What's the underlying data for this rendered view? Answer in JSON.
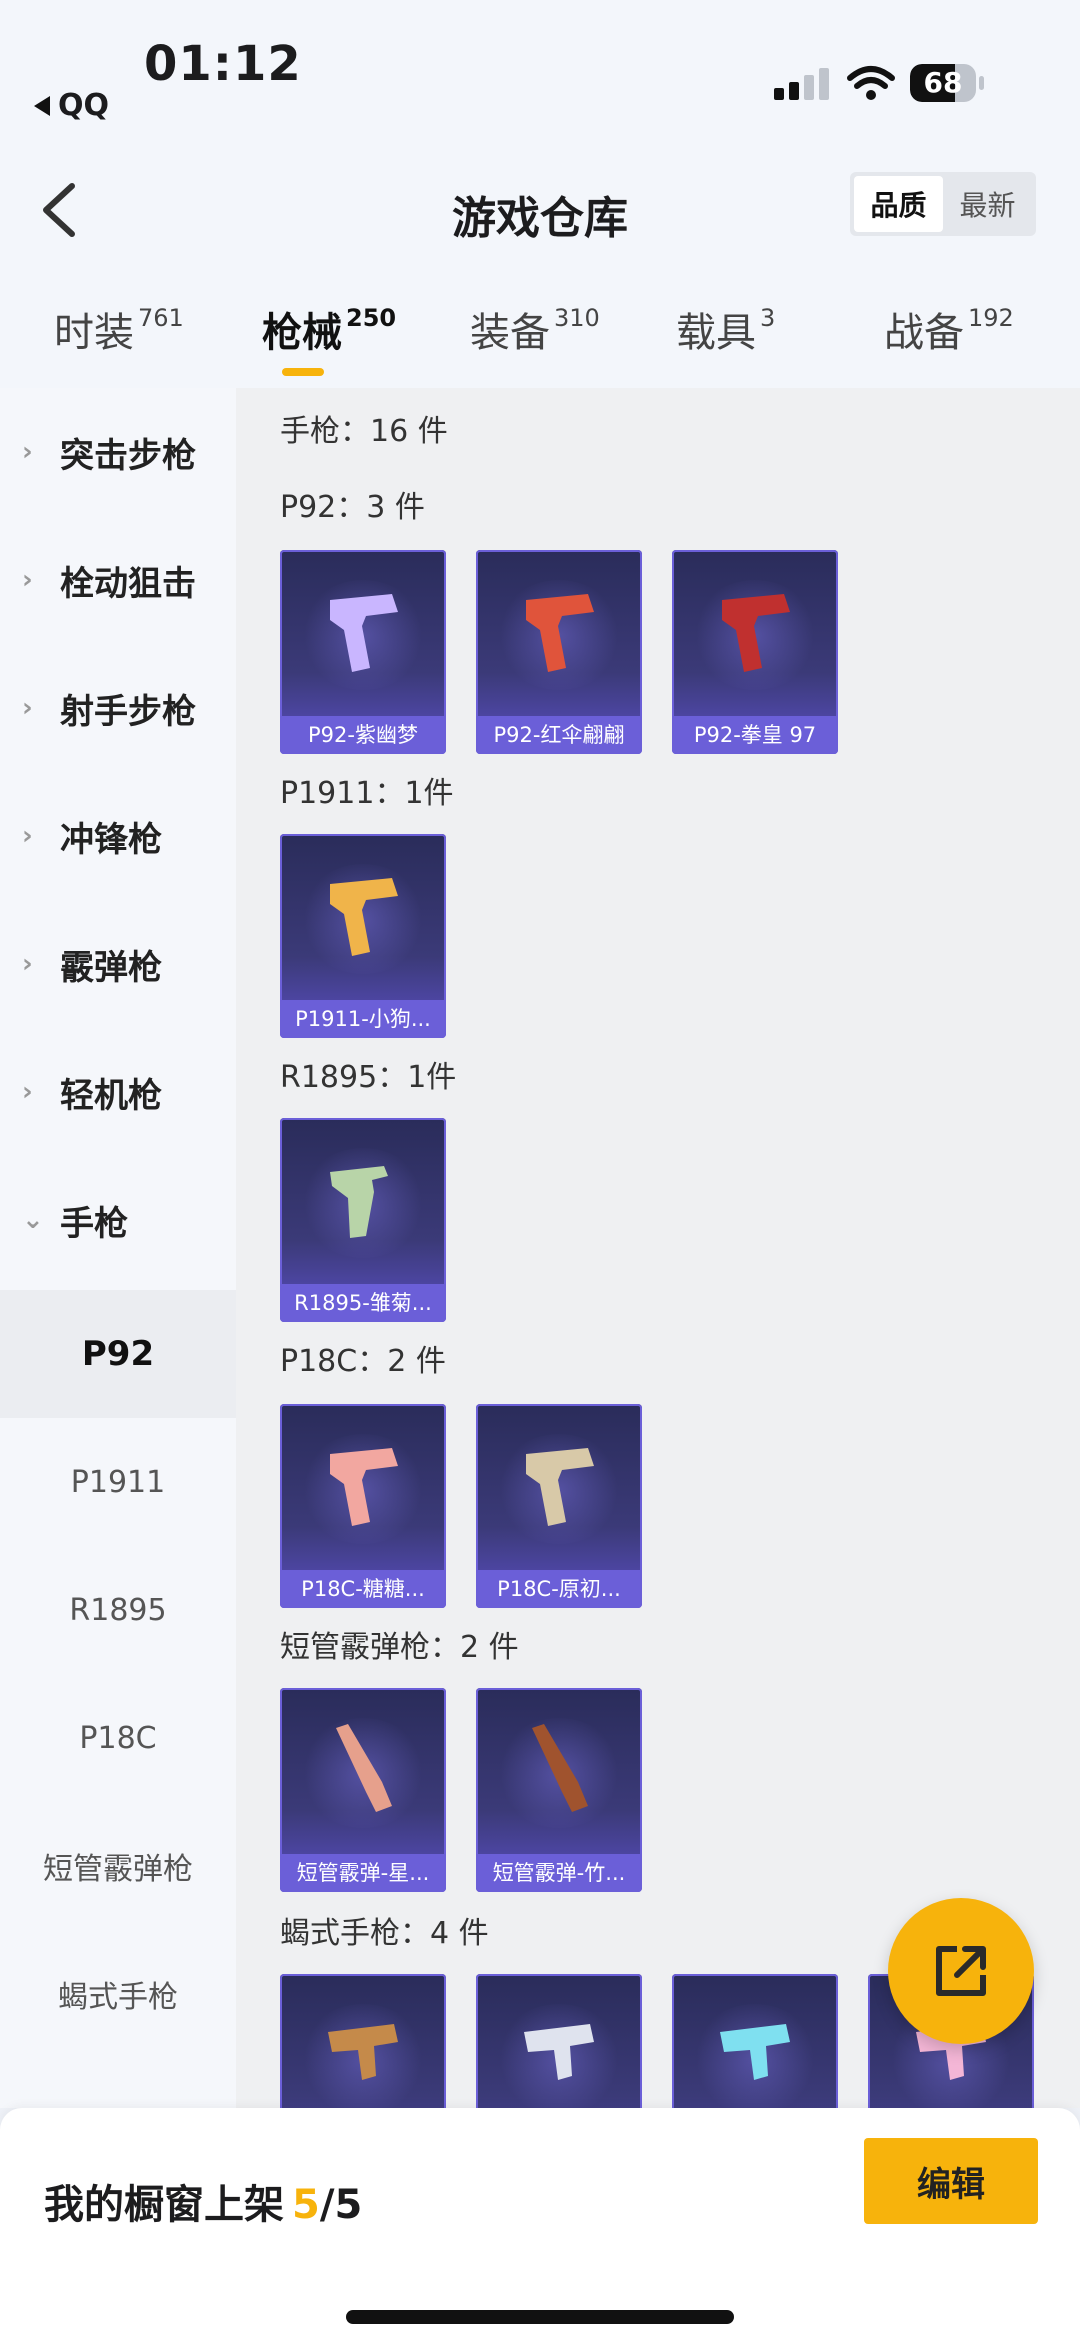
{
  "status": {
    "time": "01:12",
    "back_app": "QQ",
    "battery": "68",
    "battery_level": 0.68
  },
  "header": {
    "title": "游戏仓库",
    "sort": [
      "品质",
      "最新"
    ],
    "sort_active": 0
  },
  "tabs": [
    {
      "label": "时装",
      "count": "761"
    },
    {
      "label": "枪械",
      "count": "250"
    },
    {
      "label": "装备",
      "count": "310"
    },
    {
      "label": "载具",
      "count": "3"
    },
    {
      "label": "战备",
      "count": "192"
    }
  ],
  "active_tab": 1,
  "sidebar": {
    "categories": [
      "突击步枪",
      "栓动狙击",
      "射手步枪",
      "冲锋枪",
      "霰弹枪",
      "轻机枪",
      "手枪"
    ],
    "expanded": "手枪",
    "subitems": [
      "P92",
      "P1911",
      "R1895",
      "P18C",
      "短管霰弹枪",
      "蝎式手枪"
    ],
    "active_sub": "P92"
  },
  "content": {
    "summary": "手枪：16 件",
    "sections": [
      {
        "title": "P92：3 件",
        "items": [
          "P92-紫幽梦",
          "P92-红伞翩翩",
          "P92-拳皇 97"
        ]
      },
      {
        "title": "P1911：1件",
        "items": [
          "P1911-小狗..."
        ]
      },
      {
        "title": "R1895：1件",
        "items": [
          "R1895-雏菊..."
        ]
      },
      {
        "title": "P18C：2 件",
        "items": [
          "P18C-糖糖...",
          "P18C-原初..."
        ]
      },
      {
        "title": "短管霰弹枪：2 件",
        "items": [
          "短管霰弹-星...",
          "短管霰弹-竹..."
        ]
      },
      {
        "title": "蝎式手枪：4 件",
        "items": [
          "",
          "",
          "",
          ""
        ]
      }
    ]
  },
  "bottom": {
    "label": "我的橱窗上架",
    "count": "5",
    "total": "/5",
    "edit": "编辑"
  },
  "colors": {
    "accent": "#f7b30c",
    "card_purple": "#6b5fd8"
  }
}
